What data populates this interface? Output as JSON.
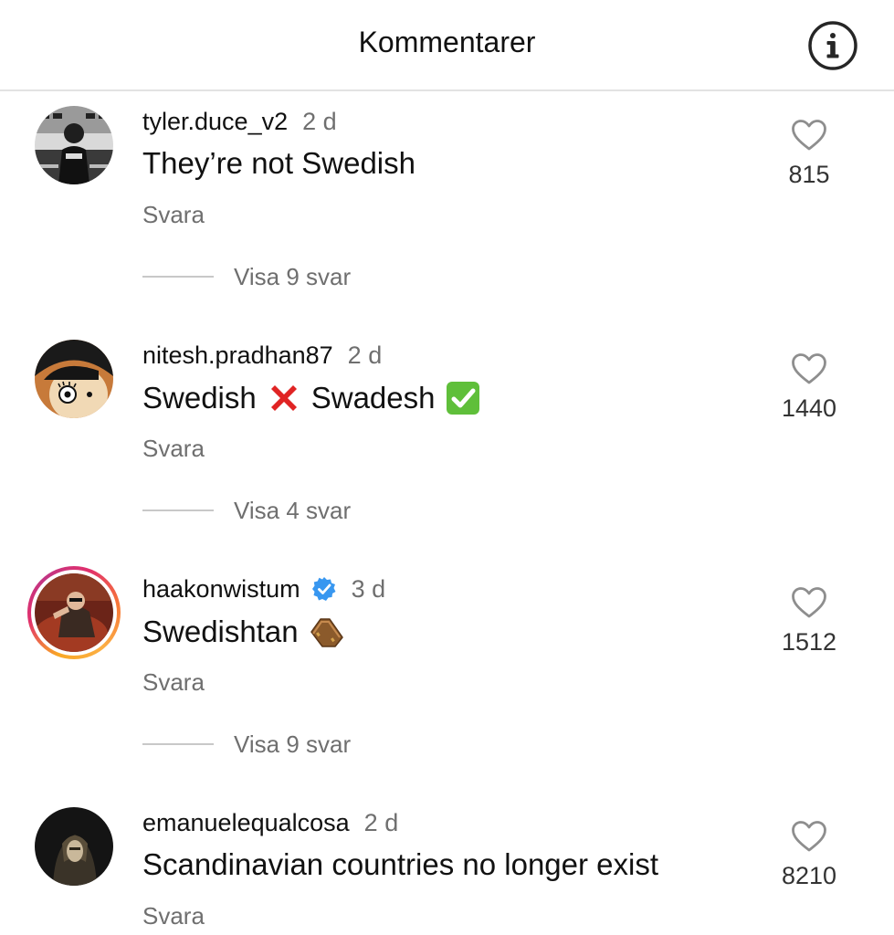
{
  "header": {
    "title": "Kommentarer",
    "info_icon": "info-circle-icon"
  },
  "comments": [
    {
      "username": "tyler.duce_v2",
      "time": "2 d",
      "verified": false,
      "text": "They’re not Swedish",
      "emoji": [],
      "reply_label": "Svara",
      "replies_label": "Visa 9 svar",
      "likes": "815",
      "story_ring": false
    },
    {
      "username": "nitesh.pradhan87",
      "time": "2 d",
      "verified": false,
      "text_parts": [
        "Swedish",
        "Swadesh"
      ],
      "emoji": [
        "cross-mark-emoji",
        "check-mark-emoji"
      ],
      "reply_label": "Svara",
      "replies_label": "Visa 4 svar",
      "likes": "1440",
      "story_ring": false
    },
    {
      "username": "haakonwistum",
      "time": "3 d",
      "verified": true,
      "text": "Swedishtan",
      "emoji": [
        "coffin-emoji"
      ],
      "reply_label": "Svara",
      "replies_label": "Visa 9 svar",
      "likes": "1512",
      "story_ring": true
    },
    {
      "username": "emanuelequalcosa",
      "time": "2 d",
      "verified": false,
      "text": "Scandinavian countries no longer exist",
      "emoji": [],
      "reply_label": "Svara",
      "likes": "8210",
      "story_ring": false
    }
  ],
  "colors": {
    "text_primary": "#111111",
    "text_secondary": "#6f6f6f",
    "divider": "#e3e3e3",
    "verified_blue": "#3897f0"
  }
}
